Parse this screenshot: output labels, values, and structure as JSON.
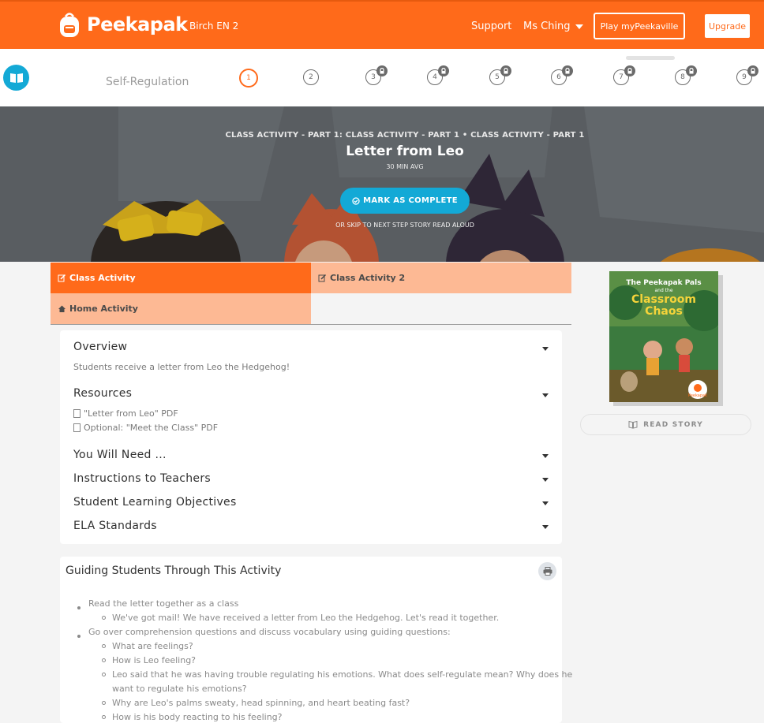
{
  "header": {
    "brand": "Peekapak",
    "class_name": "Birch EN 2",
    "separator": "|",
    "support": "Support",
    "user": "Ms Ching",
    "play_button": "Play myPeekaville",
    "upgrade_button": "Upgrade",
    "colors": {
      "brand": "#ff6a1a",
      "accent": "#13a9d6"
    }
  },
  "stepbar": {
    "unit_title": "Self-Regulation",
    "steps": [
      {
        "label": "1",
        "locked": false,
        "active": true
      },
      {
        "label": "2",
        "locked": false,
        "active": false
      },
      {
        "label": "3",
        "locked": true,
        "active": false
      },
      {
        "label": "4",
        "locked": true,
        "active": false
      },
      {
        "label": "5",
        "locked": true,
        "active": false
      },
      {
        "label": "6",
        "locked": true,
        "active": false
      },
      {
        "label": "7",
        "locked": true,
        "active": false
      },
      {
        "label": "8",
        "locked": true,
        "active": false
      },
      {
        "label": "9",
        "locked": true,
        "active": false
      }
    ]
  },
  "hero": {
    "kicker": "CLASS ACTIVITY - PART 1: CLASS ACTIVITY - PART 1 • CLASS ACTIVITY - PART 1",
    "title": "Letter from Leo",
    "time": "30 MIN AVG",
    "complete_button": "MARK AS COMPLETE",
    "skip": "OR SKIP TO NEXT STEP STORY READ ALOUD"
  },
  "tabs": [
    {
      "label": "Class Activity",
      "active": true
    },
    {
      "label": "Class Activity 2",
      "active": false
    },
    {
      "label": "Home Activity",
      "active": false
    }
  ],
  "accordion": {
    "overview_title": "Overview",
    "overview_text": "Students receive a letter from Leo the Hedgehog!",
    "resources_title": "Resources",
    "resources": [
      "\"Letter from Leo\" PDF",
      "Optional: \"Meet the Class\" PDF"
    ],
    "sections": [
      "You Will Need ...",
      "Instructions to Teachers",
      "Student Learning Objectives",
      "ELA Standards"
    ]
  },
  "guide": {
    "title": "Guiding Students Through This Activity",
    "items": [
      "Read the letter together as a class",
      "We've got mail! We have received a letter from Leo the Hedgehog. Let's read it together.",
      "Go over comprehension questions and discuss vocabulary using guiding questions:",
      "What are feelings?",
      "How is Leo feeling?",
      "Leo said that he was having trouble regulating his emotions. What does self-regulate mean? Why does he",
      "want to regulate his emotions?",
      "Why are Leo's palms sweaty, head spinning, and heart beating fast?",
      "How is his body reacting to his feeling?"
    ]
  },
  "sidebar": {
    "cover_title_top": "The Peekapak Pals",
    "cover_title_mid": "and the",
    "cover_title_main_1": "Classroom",
    "cover_title_main_2": "Chaos",
    "cover_brand": "Peekapak",
    "read_story": "READ STORY"
  }
}
